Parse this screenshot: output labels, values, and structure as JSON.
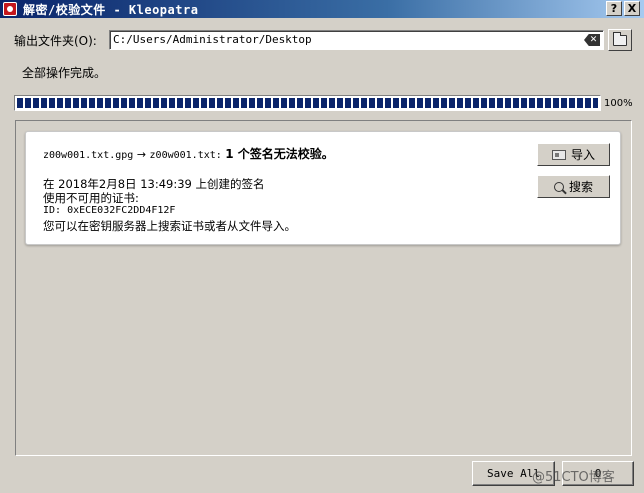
{
  "window": {
    "title": "解密/校验文件 - Kleopatra",
    "help_button": "?",
    "close_button": "X"
  },
  "output": {
    "label": "输出文件夹(O):",
    "value": "C:/Users/Administrator/Desktop"
  },
  "status": "全部操作完成。",
  "progress": {
    "percent": 100,
    "label": "100%"
  },
  "result": {
    "filename_src": "z00w001.txt.gpg",
    "arrow": "→",
    "filename_dst": "z00w001.txt:",
    "message": "1 个签名无法校验。",
    "line1": "在 2018年2月8日 13:49:39 上创建的签名",
    "line2": "使用不可用的证书:",
    "line3": "ID: 0xECE032FC2DD4F12F",
    "line4": "您可以在密钥服务器上搜索证书或者从文件导入。"
  },
  "actions": {
    "import_label": "导入",
    "search_label": "搜索"
  },
  "footer": {
    "save_all": "Save All",
    "ok_partial": "O",
    "watermark": "@51CTO博客"
  },
  "colors": {
    "titlebar": "#0a246a",
    "progress": "#0a246a",
    "window_bg": "#d4d0c8"
  },
  "icons": [
    "kleopatra-app-icon",
    "clear-icon",
    "folder-icon",
    "import-icon",
    "search-icon"
  ]
}
